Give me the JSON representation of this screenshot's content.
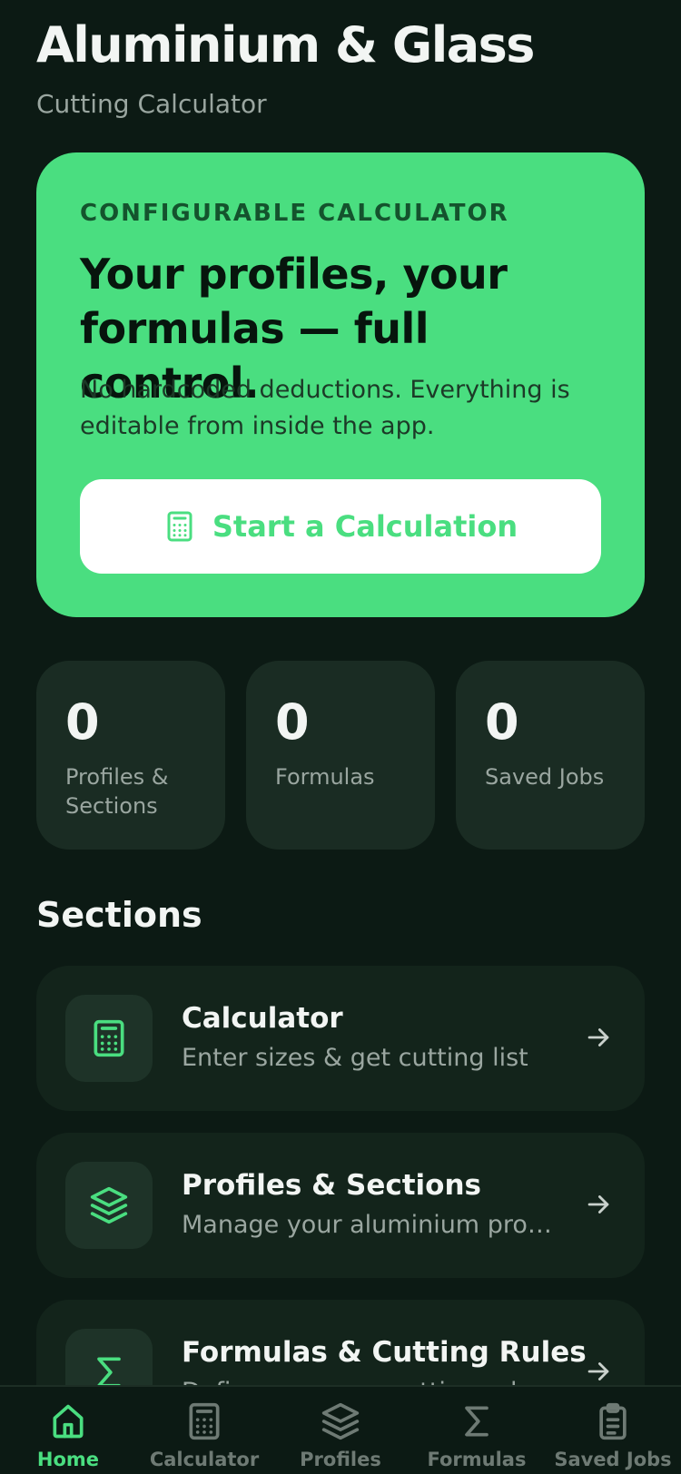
{
  "header": {
    "title": "Aluminium & Glass",
    "subtitle": "Cutting Calculator"
  },
  "hero": {
    "eyebrow": "CONFIGURABLE CALCULATOR",
    "headline": "Your profiles, your formulas — full control.",
    "description": "No hardcoded deductions. Everything is editable from inside the app.",
    "button_label": "Start a Calculation",
    "button_icon": "calculator-icon"
  },
  "stats": [
    {
      "value": "0",
      "label": "Profiles & Sections"
    },
    {
      "value": "0",
      "label": "Formulas"
    },
    {
      "value": "0",
      "label": "Saved Jobs"
    }
  ],
  "sections": {
    "heading": "Sections",
    "items": [
      {
        "title": "Calculator",
        "subtitle": "Enter sizes & get cutting list",
        "icon": "calculator-icon"
      },
      {
        "title": "Profiles & Sections",
        "subtitle": "Manage your aluminium profiles",
        "icon": "layers-icon"
      },
      {
        "title": "Formulas & Cutting Rules",
        "subtitle": "Define your own cutting rules",
        "icon": "sigma-icon"
      }
    ]
  },
  "tabbar": {
    "active": "Home",
    "items": [
      {
        "label": "Home",
        "icon": "home-icon"
      },
      {
        "label": "Calculator",
        "icon": "calculator-icon"
      },
      {
        "label": "Profiles",
        "icon": "layers-icon"
      },
      {
        "label": "Formulas",
        "icon": "sigma-icon"
      },
      {
        "label": "Saved Jobs",
        "icon": "clipboard-icon"
      }
    ]
  },
  "colors": {
    "background": "#0c1a14",
    "accent": "#4ade80",
    "card": "#13241b",
    "stat_card": "#1a2c23",
    "muted_text": "#9aa6a0",
    "inactive_tab": "#6e7a74"
  }
}
